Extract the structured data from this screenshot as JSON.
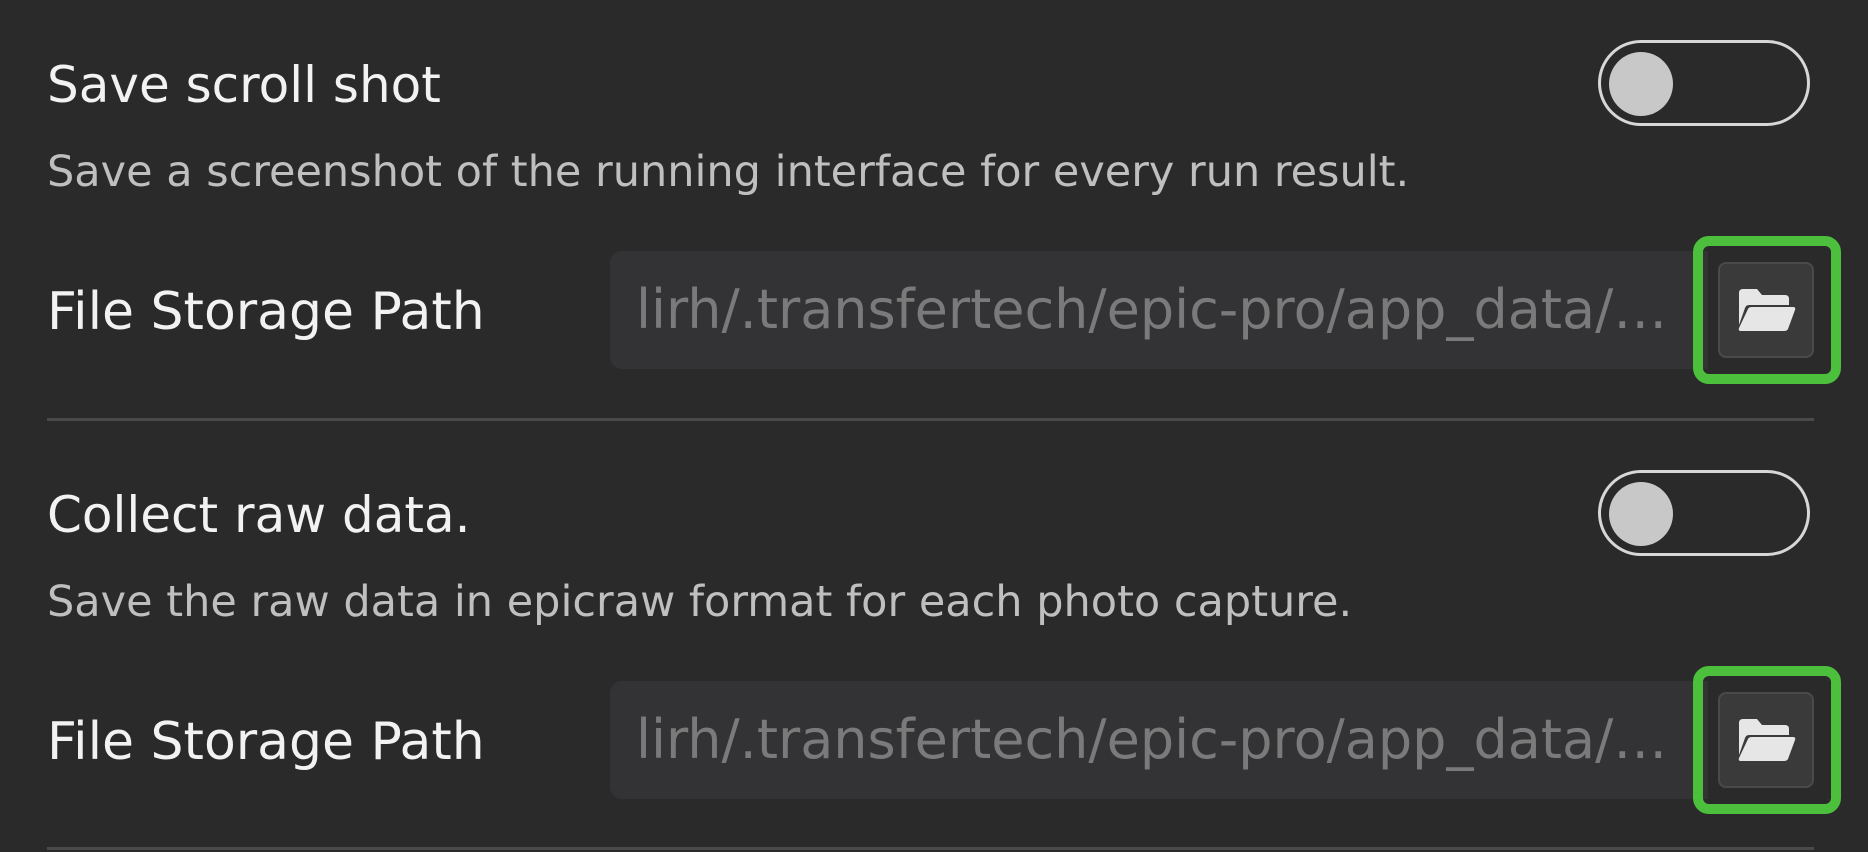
{
  "settings": {
    "scroll_shot": {
      "title": "Save scroll shot",
      "description": "Save a screenshot of the running interface for every run result.",
      "toggle_enabled": false,
      "path_label": "File Storage Path",
      "path_value": "lirh/.transfertech/epic-pro/app_data/…",
      "folder_icon": "folder-open-icon"
    },
    "raw_data": {
      "title": "Collect raw data.",
      "description": "Save the raw data in epicraw format for each photo capture.",
      "toggle_enabled": false,
      "path_label": "File Storage Path",
      "path_value": "lirh/.transfertech/epic-pro/app_data/…",
      "folder_icon": "folder-open-icon"
    }
  },
  "colors": {
    "background": "#2a2a2a",
    "highlight": "#4cbf3d",
    "field_background": "#333336",
    "toggle_border": "#d7d7d7"
  }
}
